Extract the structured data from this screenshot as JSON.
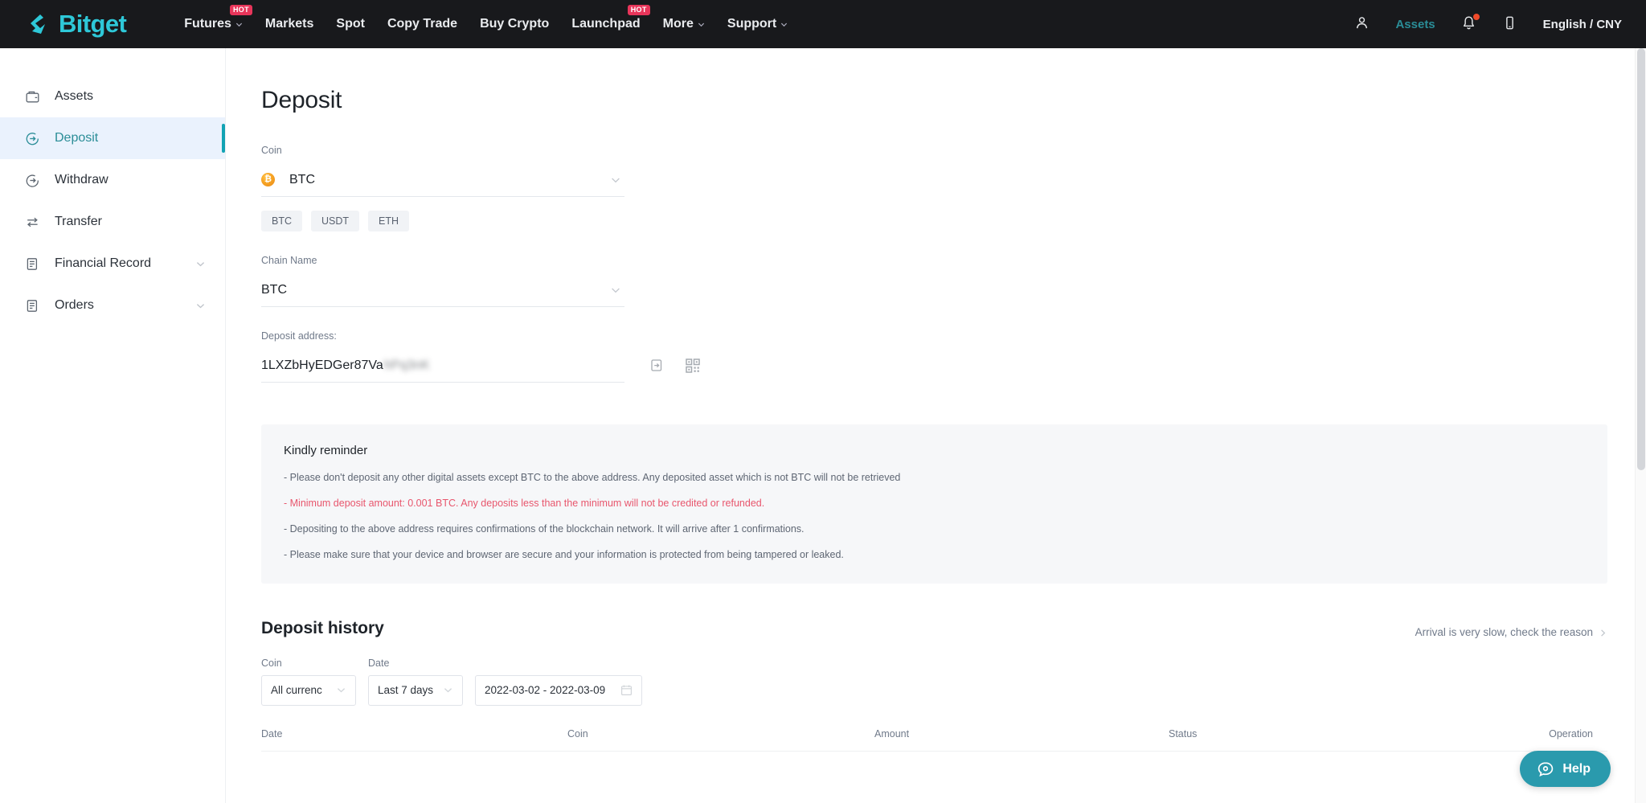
{
  "header": {
    "logo_text": "Bitget",
    "nav": [
      {
        "label": "Futures",
        "caret": true,
        "hot": "HOT"
      },
      {
        "label": "Markets",
        "caret": false,
        "hot": ""
      },
      {
        "label": "Spot",
        "caret": false,
        "hot": ""
      },
      {
        "label": "Copy Trade",
        "caret": false,
        "hot": ""
      },
      {
        "label": "Buy Crypto",
        "caret": false,
        "hot": ""
      },
      {
        "label": "Launchpad",
        "caret": false,
        "hot": "HOT"
      },
      {
        "label": "More",
        "caret": true,
        "hot": ""
      },
      {
        "label": "Support",
        "caret": true,
        "hot": ""
      }
    ],
    "assets_label": "Assets",
    "language_label": "English / CNY",
    "accent_color": "#2ec8d8",
    "hot_color": "#e8355a",
    "notification_color": "#f04a2a"
  },
  "sidebar": {
    "items": [
      {
        "label": "Assets",
        "icon": "wallet-icon",
        "chevron": false,
        "active": false
      },
      {
        "label": "Deposit",
        "icon": "deposit-icon",
        "chevron": false,
        "active": true
      },
      {
        "label": "Withdraw",
        "icon": "withdraw-icon",
        "chevron": false,
        "active": false
      },
      {
        "label": "Transfer",
        "icon": "transfer-icon",
        "chevron": false,
        "active": false
      },
      {
        "label": "Financial Record",
        "icon": "record-icon",
        "chevron": true,
        "active": false
      },
      {
        "label": "Orders",
        "icon": "orders-icon",
        "chevron": true,
        "active": false
      }
    ],
    "active_color": "#2a8d97",
    "active_bg": "#eaf2fd"
  },
  "deposit": {
    "page_title": "Deposit",
    "coin_label": "Coin",
    "coin_value": "BTC",
    "coin_chips": [
      "BTC",
      "USDT",
      "ETH"
    ],
    "chain_label": "Chain Name",
    "chain_value": "BTC",
    "address_label": "Deposit address:",
    "address_value": "1LXZbHyEDGer87Va",
    "address_masked_tail": "hPq3nK",
    "copy_icon": "copy-icon",
    "qr_icon": "qr-code-icon"
  },
  "reminder": {
    "title": "Kindly reminder",
    "lines": [
      {
        "text": "- Please don't deposit any other digital assets except BTC to the above address. Any deposited asset which is not BTC will not be retrieved",
        "warn": false
      },
      {
        "text": "- Minimum deposit amount: 0.001 BTC. Any deposits less than the minimum will not be credited or refunded.",
        "warn": true
      },
      {
        "text": "- Depositing to the above address requires confirmations of the blockchain network. It will arrive after 1 confirmations.",
        "warn": false
      },
      {
        "text": "- Please make sure that your device and browser are secure and your information is protected from being tampered or leaked.",
        "warn": false
      }
    ],
    "warn_color": "#e8566d"
  },
  "history": {
    "title": "Deposit history",
    "link_label": "Arrival is very slow, check the reason",
    "coin_filter_label": "Coin",
    "coin_filter_value": "All currenc",
    "date_filter_label": "Date",
    "date_range_preset": "Last 7 days",
    "date_range_value": "2022-03-02 - 2022-03-09",
    "columns": [
      "Date",
      "Coin",
      "Amount",
      "Status",
      "Operation"
    ]
  },
  "help": {
    "label": "Help",
    "icon": "chat-bubble-icon",
    "color": "#2a9aad"
  }
}
